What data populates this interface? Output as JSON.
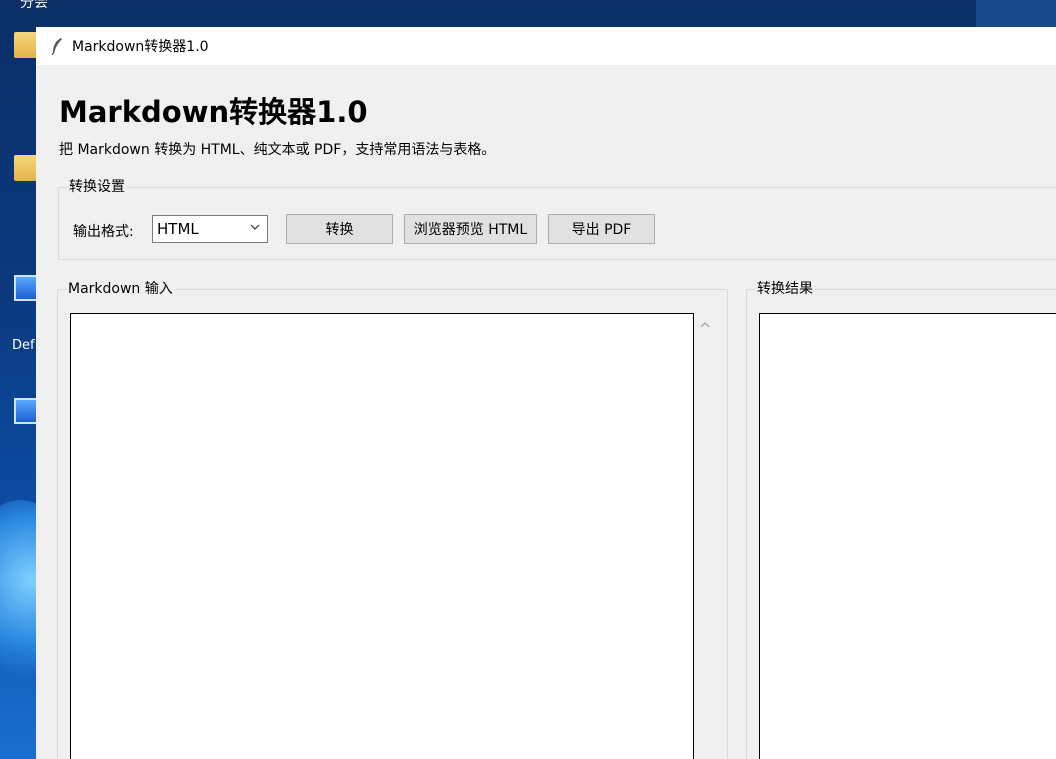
{
  "desktop": {
    "top_text": "分会",
    "icon_labels": [
      "Def"
    ]
  },
  "window": {
    "title": "Markdown转换器1.0"
  },
  "app": {
    "heading": "Markdown转换器1.0",
    "subtitle": "把 Markdown 转换为 HTML、纯文本或 PDF，支持常用语法与表格。"
  },
  "settings": {
    "group_label": "转换设置",
    "format_label": "输出格式:",
    "format_value": "HTML",
    "convert_label": "转换",
    "preview_label": "浏览器预览 HTML",
    "export_pdf_label": "导出 PDF"
  },
  "input": {
    "group_label": "Markdown 输入",
    "value": ""
  },
  "result": {
    "group_label": "转换结果",
    "value": ""
  }
}
